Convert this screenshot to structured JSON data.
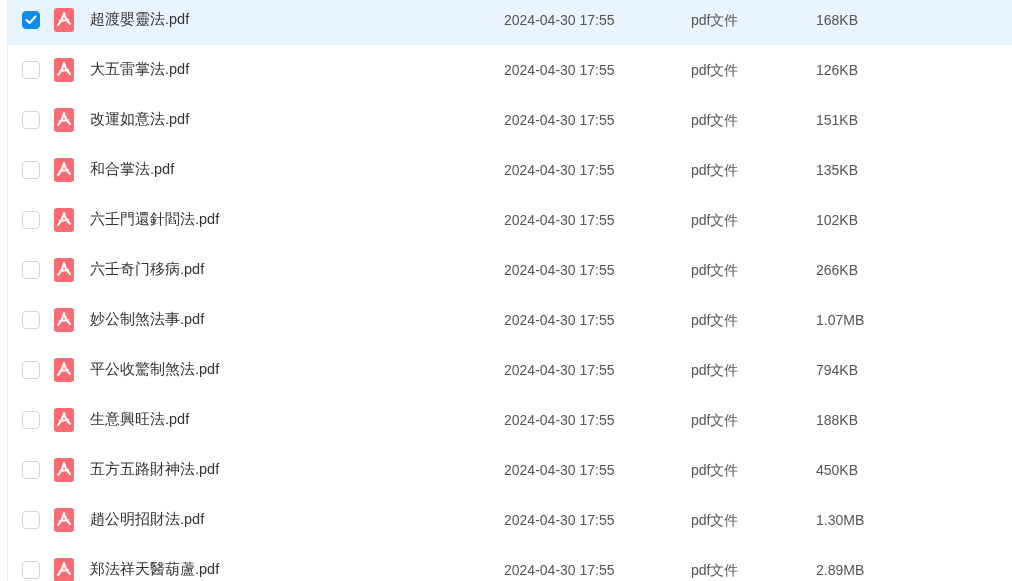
{
  "files": [
    {
      "name": "超渡嬰靈法.pdf",
      "date": "2024-04-30 17:55",
      "type": "pdf文件",
      "size": "168KB",
      "selected": true
    },
    {
      "name": "大五雷掌法.pdf",
      "date": "2024-04-30 17:55",
      "type": "pdf文件",
      "size": "126KB",
      "selected": false
    },
    {
      "name": "改運如意法.pdf",
      "date": "2024-04-30 17:55",
      "type": "pdf文件",
      "size": "151KB",
      "selected": false
    },
    {
      "name": "和合掌法.pdf",
      "date": "2024-04-30 17:55",
      "type": "pdf文件",
      "size": "135KB",
      "selected": false
    },
    {
      "name": "六壬門還針閻法.pdf",
      "date": "2024-04-30 17:55",
      "type": "pdf文件",
      "size": "102KB",
      "selected": false
    },
    {
      "name": "六壬奇门移病.pdf",
      "date": "2024-04-30 17:55",
      "type": "pdf文件",
      "size": "266KB",
      "selected": false
    },
    {
      "name": "妙公制煞法事.pdf",
      "date": "2024-04-30 17:55",
      "type": "pdf文件",
      "size": "1.07MB",
      "selected": false
    },
    {
      "name": "平公收驚制煞法.pdf",
      "date": "2024-04-30 17:55",
      "type": "pdf文件",
      "size": "794KB",
      "selected": false
    },
    {
      "name": "生意興旺法.pdf",
      "date": "2024-04-30 17:55",
      "type": "pdf文件",
      "size": "188KB",
      "selected": false
    },
    {
      "name": "五方五路財神法.pdf",
      "date": "2024-04-30 17:55",
      "type": "pdf文件",
      "size": "450KB",
      "selected": false
    },
    {
      "name": "趙公明招財法.pdf",
      "date": "2024-04-30 17:55",
      "type": "pdf文件",
      "size": "1.30MB",
      "selected": false
    },
    {
      "name": "郑法祥天醫葫蘆.pdf",
      "date": "2024-04-30 17:55",
      "type": "pdf文件",
      "size": "2.89MB",
      "selected": false
    }
  ]
}
